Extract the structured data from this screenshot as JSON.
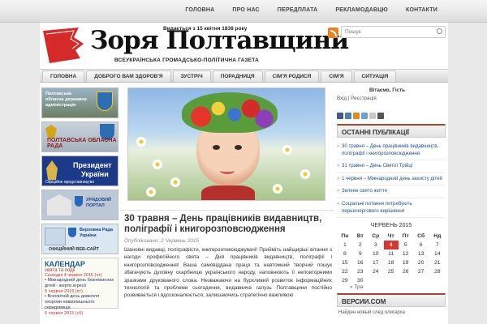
{
  "top_nav": [
    "ГОЛОВНА",
    "ПРО НАС",
    "ПЕРЕДПЛАТА",
    "РЕКЛАМОДАВЦЮ",
    "КОНТАКТИ"
  ],
  "header": {
    "since": "Видається з 15 квітня 1838 року",
    "title": "Зоря Полтавщини",
    "subtitle": "ВСЕУКРАЇНСЬКА ГРОМАДСЬКО-ПОЛІТИЧНА ГАЗЕТА"
  },
  "search": {
    "placeholder": "Пошук"
  },
  "main_nav": [
    "ГОЛОВНА",
    "ДОБРОГО ВАМ ЗДОРОВ'Я",
    "ЗУСТРІЧ",
    "ПОРАДНИЦЯ",
    "СІМ'Я РОДИСЯ",
    "СІМ'Я",
    "СИТУАЦІЯ"
  ],
  "banners": {
    "b1": "Полтавська обласна державна адміністрація",
    "b2": "ПОЛТАВСЬКА ОБЛАСНА РАДА",
    "b3_top": "Президент",
    "b3_bottom": "України",
    "b3_caption": "Офіційне представництво",
    "b4": "УРЯДОВИЙ ПОРТАЛ",
    "b5_top": "Верховна Рада України",
    "b5_caption": "ОФІЦІЙНИЙ ВЕБ-САЙТ",
    "calendar_title": "КАЛЕНДАР",
    "calendar_sub": "свята та події",
    "calendar_today": "Сьогодні 4 червня 2015 (чт)",
    "calendar_item1": "• Міжнародний день безневинних дітей - жертв агресії",
    "calendar_date1": "5 червня 2015 (пт)",
    "calendar_item2": "• Всесвітній день довкілля охорони навколишнього середовища",
    "calendar_date2": "6 червня 2015 (сб)"
  },
  "article": {
    "title": "30 травня – День працівників видавництв, поліграфії і книгорозповсюдження",
    "meta": "Опубліковано: 2 Червень 2015",
    "body": "Шановні видавці, поліграфісти, книгорозповсюджувачі! Прийміть найщиріші вітання з нагоди професійного свята – Дня працівників видавництв, поліграфії і книгорозповсюдження! Ваша самовіддана праця та невтомний творчий пошук збагачують духовну скарбницю українського народу, наповнюють її неповторними зразками друкованого слова. Незважаючи на бурхливий розвиток інформаційних технологій та проблеми сьогодення, видавнича галузь Полтавщини постійно розвивається і вдосконалюється, залишаючись стратегічно важливою"
  },
  "sidebar": {
    "hello": "Вітаємо, Гість",
    "login": "Вхід | Реєстрація",
    "recent_title": "ОСТАННІ ПУБЛІКАЦІЇ",
    "recent": [
      "30 травня – День працівників видавництв, поліграфії і книгорозповсюдження",
      "31 травня – День Святої Трійці",
      "1 червня – Міжнародний день захисту дітей",
      "Зелене свято життя",
      "Соціальні питання потребують першочергового вирішення"
    ],
    "calendar_month": "ЧЕРВЕНЬ 2015",
    "weekdays": [
      "Пн",
      "Вт",
      "Ср",
      "Чт",
      "Пт",
      "Сб",
      "Нд"
    ],
    "weeks": [
      [
        "1",
        "2",
        "3",
        "4",
        "5",
        "6",
        "7"
      ],
      [
        "8",
        "9",
        "10",
        "11",
        "12",
        "13",
        "14"
      ],
      [
        "15",
        "16",
        "17",
        "18",
        "19",
        "20",
        "21"
      ],
      [
        "22",
        "23",
        "24",
        "25",
        "26",
        "27",
        "28"
      ],
      [
        "29",
        "30",
        "",
        "",
        "",
        "",
        ""
      ]
    ],
    "today": "4",
    "prev": "« Тра",
    "versions_title": "ВЕРСИИ.COM",
    "versions_text": "Найден новый след олигарха"
  },
  "colors": {
    "accent": "#cc3333",
    "link": "#1e4f8f"
  }
}
